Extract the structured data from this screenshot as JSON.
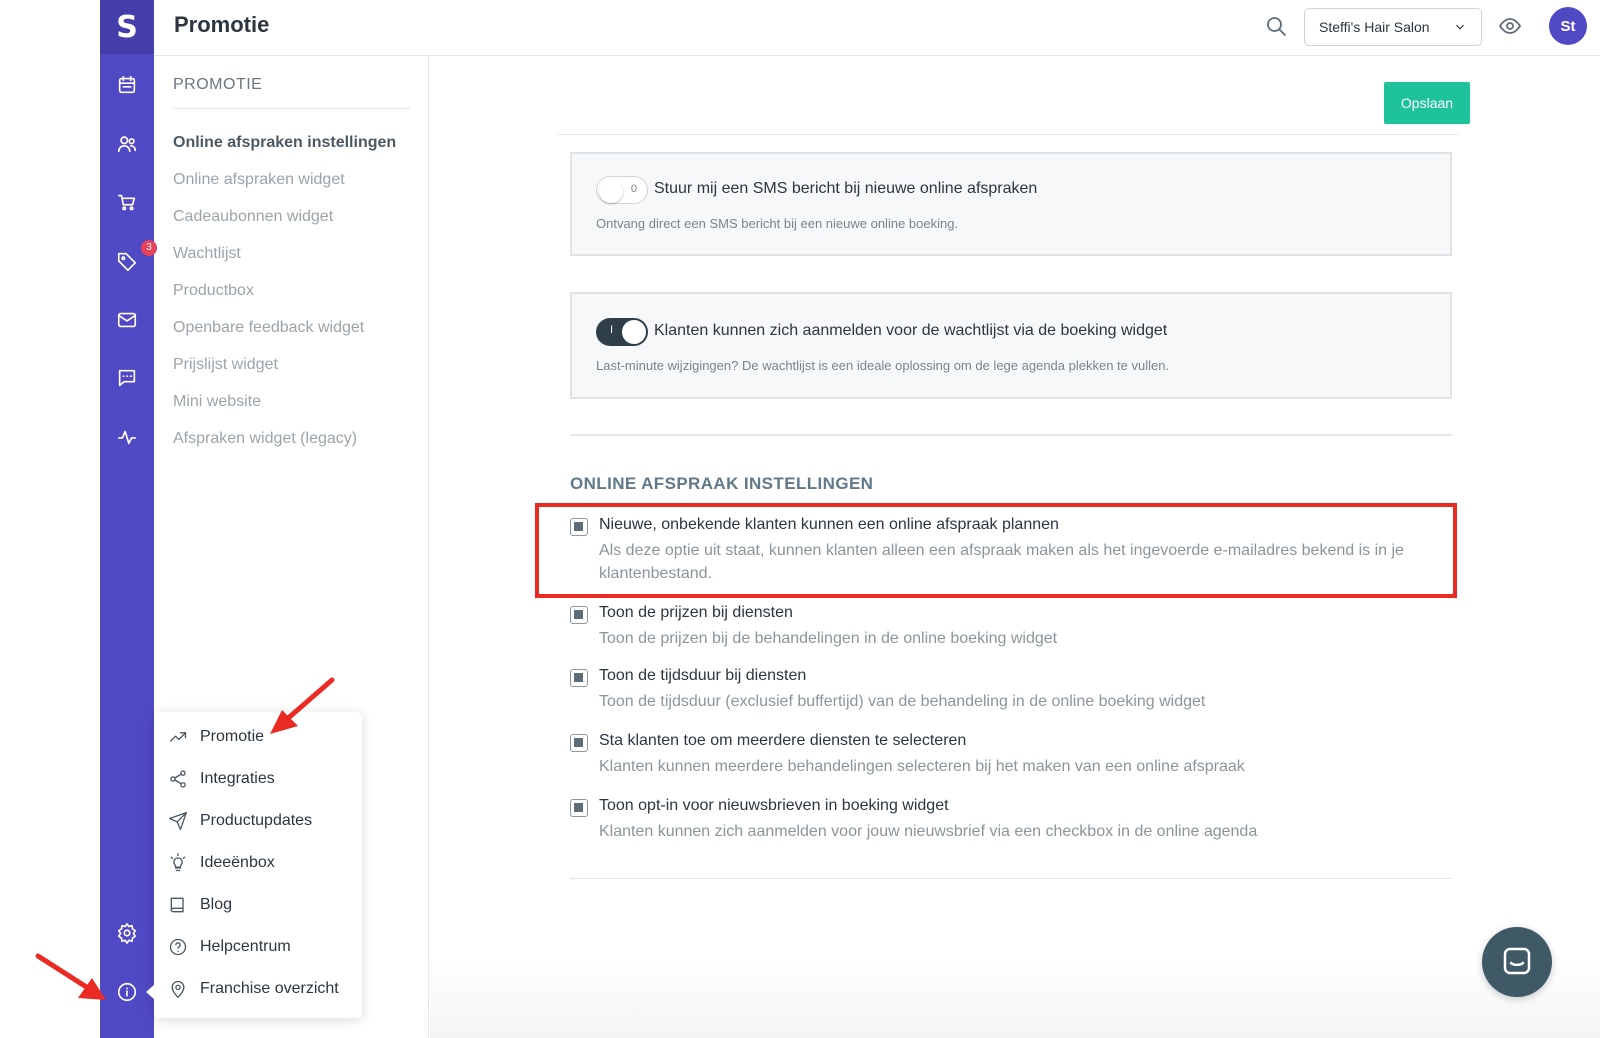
{
  "header": {
    "title": "Promotie",
    "salon_name": "Steffi's Hair Salon",
    "avatar_initials": "St"
  },
  "rail": {
    "logo": "S",
    "icons": [
      "calendar-icon",
      "users-icon",
      "cart-icon",
      "tag-icon",
      "mail-icon",
      "chat-icon",
      "activity-icon",
      "settings-icon",
      "info-icon"
    ],
    "tag_badge": "3"
  },
  "subnav": {
    "heading": "PROMOTIE",
    "items": [
      "Online afspraken instellingen",
      "Online afspraken widget",
      "Cadeaubonnen widget",
      "Wachtlijst",
      "Productbox",
      "Openbare feedback widget",
      "Prijslijst widget",
      "Mini website",
      "Afspraken widget (legacy)"
    ]
  },
  "main": {
    "save_label": "Opslaan",
    "sms_card": {
      "toggle_label": "0",
      "title": "Stuur mij een SMS bericht bij nieuwe online afspraken",
      "desc": "Ontvang direct een SMS bericht bij een nieuwe online boeking.",
      "enabled": false
    },
    "waitlist_card": {
      "toggle_label": "I",
      "title": "Klanten kunnen zich aanmelden voor de wachtlijst via de boeking widget",
      "desc": "Last-minute wijzigingen? De wachtlijst is een ideale oplossing om de lege agenda plekken te vullen.",
      "enabled": true
    },
    "section_title": "ONLINE AFSPRAAK INSTELLINGEN",
    "options": [
      {
        "title": "Nieuwe, onbekende klanten kunnen een online afspraak plannen",
        "desc": "Als deze optie uit staat, kunnen klanten alleen een afspraak maken als het ingevoerde e-mailadres bekend is in je klantenbestand."
      },
      {
        "title": "Toon de prijzen bij diensten",
        "desc": "Toon de prijzen bij de behandelingen in de online boeking widget"
      },
      {
        "title": "Toon de tijdsduur bij diensten",
        "desc": "Toon de tijdsduur (exclusief buffertijd) van de behandeling in de online boeking widget"
      },
      {
        "title": "Sta klanten toe om meerdere diensten te selecteren",
        "desc": "Klanten kunnen meerdere behandelingen selecteren bij het maken van een online afspraak"
      },
      {
        "title": "Toon opt-in voor nieuwsbrieven in boeking widget",
        "desc": "Klanten kunnen zich aanmelden voor jouw nieuwsbrief via een checkbox in de online agenda"
      }
    ]
  },
  "popup_menu": {
    "items": [
      {
        "label": "Promotie",
        "icon": "trending-up-icon"
      },
      {
        "label": "Integraties",
        "icon": "share-icon"
      },
      {
        "label": "Productupdates",
        "icon": "send-icon"
      },
      {
        "label": "Ideeënbox",
        "icon": "lightbulb-icon"
      },
      {
        "label": "Blog",
        "icon": "book-icon"
      },
      {
        "label": "Helpcentrum",
        "icon": "help-icon"
      },
      {
        "label": "Franchise overzicht",
        "icon": "location-pin-icon"
      }
    ]
  },
  "colors": {
    "rail": "#5049c4",
    "save": "#1fc39b",
    "highlight": "#ea2b24",
    "arrow": "#ea2b24"
  }
}
